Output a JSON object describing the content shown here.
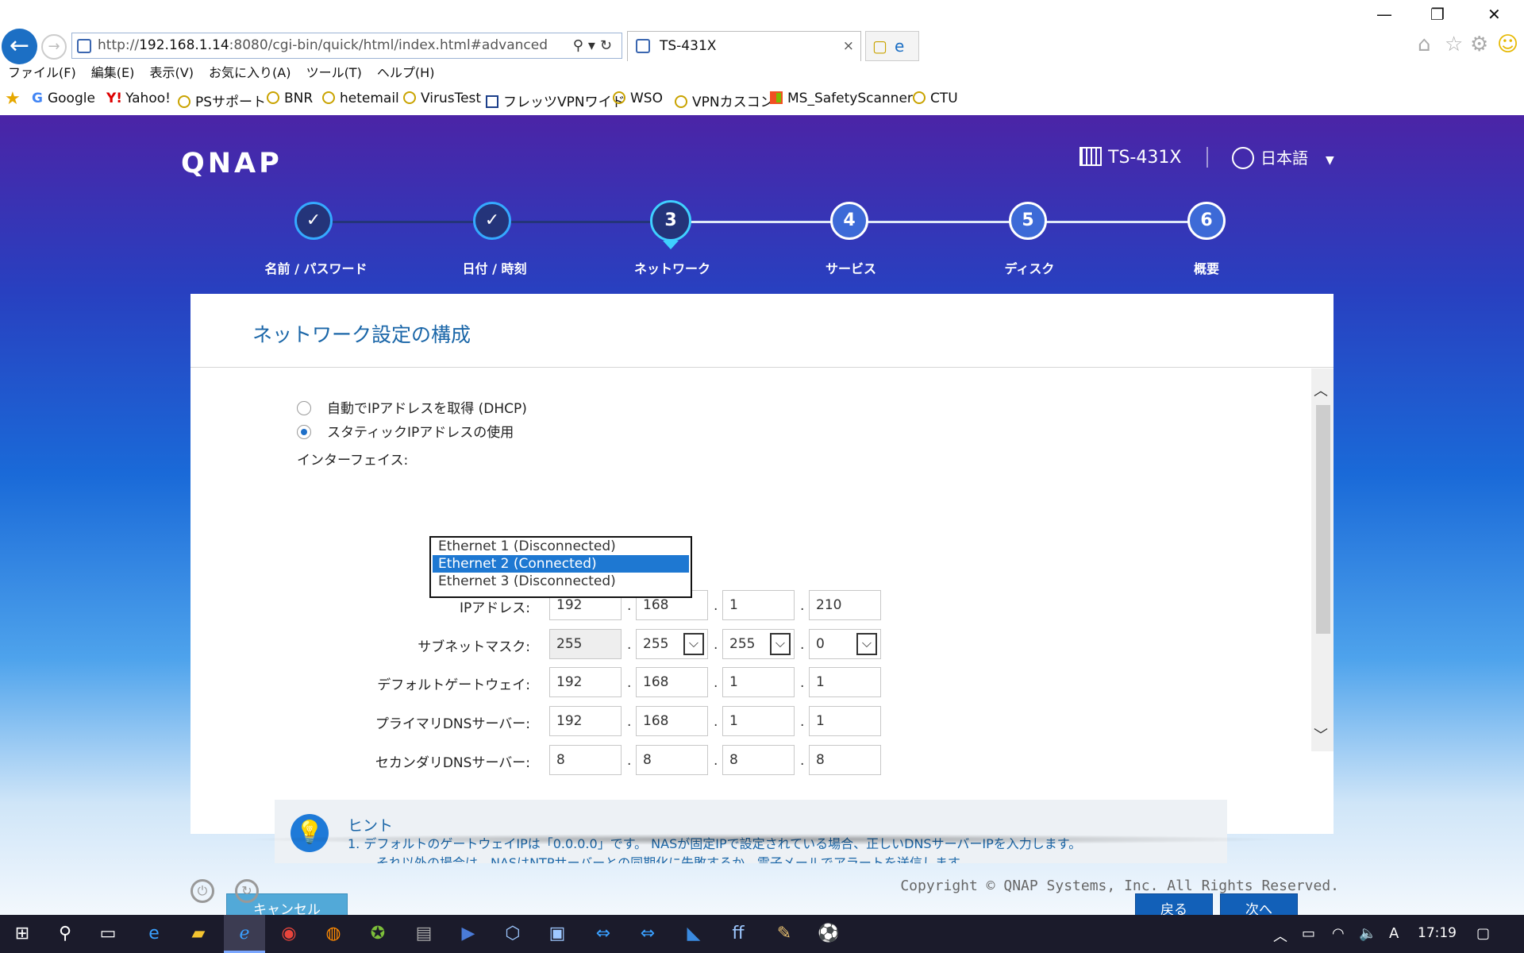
{
  "browser": {
    "address_prefix": "http://",
    "address_host": "192.168.1.14",
    "address_rest": ":8080/cgi-bin/quick/html/index.html#advanced",
    "tab_title": "TS-431X",
    "menu": [
      "ファイル(F)",
      "編集(E)",
      "表示(V)",
      "お気に入り(A)",
      "ツール(T)",
      "ヘルプ(H)"
    ],
    "favorites": [
      "Google",
      "Yahoo!",
      "PSサポート",
      "BNR",
      "hetemail",
      "VirusTest",
      "フレッツVPNワイド",
      "WSO",
      "VPNカスコン",
      "MS_SafetyScanner",
      "CTU"
    ]
  },
  "header": {
    "logo": "QNAP",
    "model": "TS-431X",
    "language": "日本語"
  },
  "steps": [
    {
      "num": "✓",
      "label": "名前 / パスワード",
      "state": "done"
    },
    {
      "num": "✓",
      "label": "日付 / 時刻",
      "state": "done"
    },
    {
      "num": "3",
      "label": "ネットワーク",
      "state": "active"
    },
    {
      "num": "4",
      "label": "サービス",
      "state": "future"
    },
    {
      "num": "5",
      "label": "ディスク",
      "state": "future"
    },
    {
      "num": "6",
      "label": "概要",
      "state": "future"
    }
  ],
  "panel": {
    "title": "ネットワーク設定の構成",
    "dhcp_label": "自動でIPアドレスを取得 (DHCP)",
    "static_label": "スタティックIPアドレスの使用",
    "interface_label": "インターフェイス:",
    "interface_options": [
      "Ethernet 1 (Disconnected)",
      "Ethernet 2 (Connected)",
      "Ethernet 3 (Disconnected)"
    ],
    "interface_selected_index": 1,
    "fields": [
      {
        "label": "IPアドレス:",
        "values": [
          "192",
          "168",
          "1",
          "210"
        ]
      },
      {
        "label": "サブネットマスク:",
        "values": [
          "255",
          "255",
          "255",
          "0"
        ]
      },
      {
        "label": "デフォルトゲートウェイ:",
        "values": [
          "192",
          "168",
          "1",
          "1"
        ]
      },
      {
        "label": "プライマリDNSサーバー:",
        "values": [
          "192",
          "168",
          "1",
          "1"
        ]
      },
      {
        "label": "セカンダリDNSサーバー:",
        "values": [
          "8",
          "8",
          "8",
          "8"
        ]
      }
    ],
    "hint_title": "ヒント",
    "hint_line1": "1.  デフォルトのゲートウェイIPは「0.0.0.0」です。 NASが固定IPで設定されている場合、正しいDNSサーバーIPを入力します。",
    "hint_line2": "それ以外の場合は、NASはNTPサーバーとの同期化に失敗するか、電子メールでアラートを送信します。",
    "cancel": "キャンセル",
    "back": "戻る",
    "next": "次へ"
  },
  "footer": {
    "copyright": "Copyright © QNAP Systems, Inc. All Rights Reserved."
  },
  "taskbar": {
    "clock": "17:19"
  },
  "colors": {
    "accent": "#1260b8",
    "title_blue": "#1a66a8",
    "selected_option": "#1e78d2"
  }
}
